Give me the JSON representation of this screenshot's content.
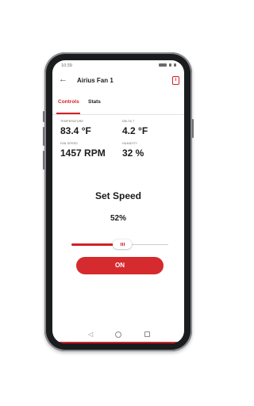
{
  "status_bar": {
    "time": "10:39"
  },
  "app_bar": {
    "title": "Airius Fan 1",
    "back_icon": "arrow-left-icon",
    "info_icon": "info-icon"
  },
  "tabs": [
    {
      "label": "Controls",
      "active": true
    },
    {
      "label": "Stats",
      "active": false
    }
  ],
  "stats": {
    "temperature": {
      "label": "TEMPERATURE",
      "value": "83.4 °F"
    },
    "delta_t": {
      "label": "DELTA T",
      "value": "4.2 °F"
    },
    "fan_speed": {
      "label": "FAN SPEED",
      "value": "1457 RPM"
    },
    "humidity": {
      "label": "HUMIDITY",
      "value": "32 %"
    }
  },
  "speed": {
    "title": "Set Speed",
    "value_text": "52%",
    "level": 0.52
  },
  "power_button": {
    "label": "ON"
  },
  "colors": {
    "accent": "#d32027",
    "button": "#d52a2e"
  }
}
